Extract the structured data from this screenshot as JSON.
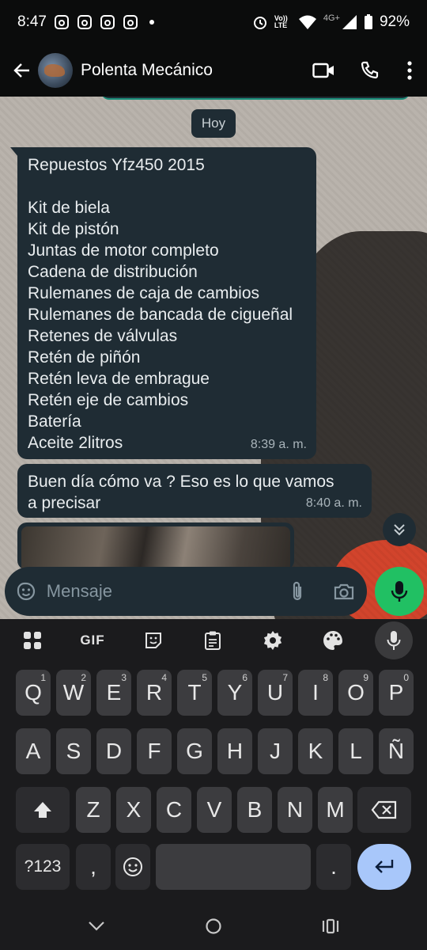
{
  "status_bar": {
    "time": "8:47",
    "network": "4G+",
    "volte": "Vo)) LTE",
    "battery": "92%"
  },
  "header": {
    "contact_name": "Polenta Mecánico",
    "icons": [
      "back-arrow-icon",
      "video-call-icon",
      "voice-call-icon",
      "more-options-icon"
    ]
  },
  "chat": {
    "day_label": "Hoy",
    "messages": [
      {
        "lines": [
          "Repuestos Yfz450 2015",
          "",
          "Kit de biela",
          "Kit de pistón",
          "Juntas de motor completo",
          "Cadena de distribución",
          "Rulemanes de caja de cambios",
          "Rulemanes de bancada de cigueñal",
          "Retenes de válvulas",
          "Retén de piñón",
          "Retén leva de embrague",
          "Retén eje de cambios",
          "Batería",
          "Aceite 2litros"
        ],
        "time": "8:39 a. m."
      },
      {
        "lines": [
          "Buen día cómo va ? Eso es lo que vamos",
          "a precisar"
        ],
        "time": "8:40 a. m."
      }
    ]
  },
  "composer": {
    "placeholder": "Mensaje"
  },
  "keyboard": {
    "toolbar": {
      "gif_label": "GIF"
    },
    "row1": [
      {
        "k": "Q",
        "n": "1"
      },
      {
        "k": "W",
        "n": "2"
      },
      {
        "k": "E",
        "n": "3"
      },
      {
        "k": "R",
        "n": "4"
      },
      {
        "k": "T",
        "n": "5"
      },
      {
        "k": "Y",
        "n": "6"
      },
      {
        "k": "U",
        "n": "7"
      },
      {
        "k": "I",
        "n": "8"
      },
      {
        "k": "O",
        "n": "9"
      },
      {
        "k": "P",
        "n": "0"
      }
    ],
    "row2": [
      "A",
      "S",
      "D",
      "F",
      "G",
      "H",
      "J",
      "K",
      "L",
      "Ñ"
    ],
    "row3": [
      "Z",
      "X",
      "C",
      "V",
      "B",
      "N",
      "M"
    ],
    "symbols_label": "?123",
    "comma": ",",
    "period": "."
  },
  "colors": {
    "bubble": "#1f2c34",
    "accent_green": "#21c063",
    "enter_key": "#a8c7fa"
  }
}
